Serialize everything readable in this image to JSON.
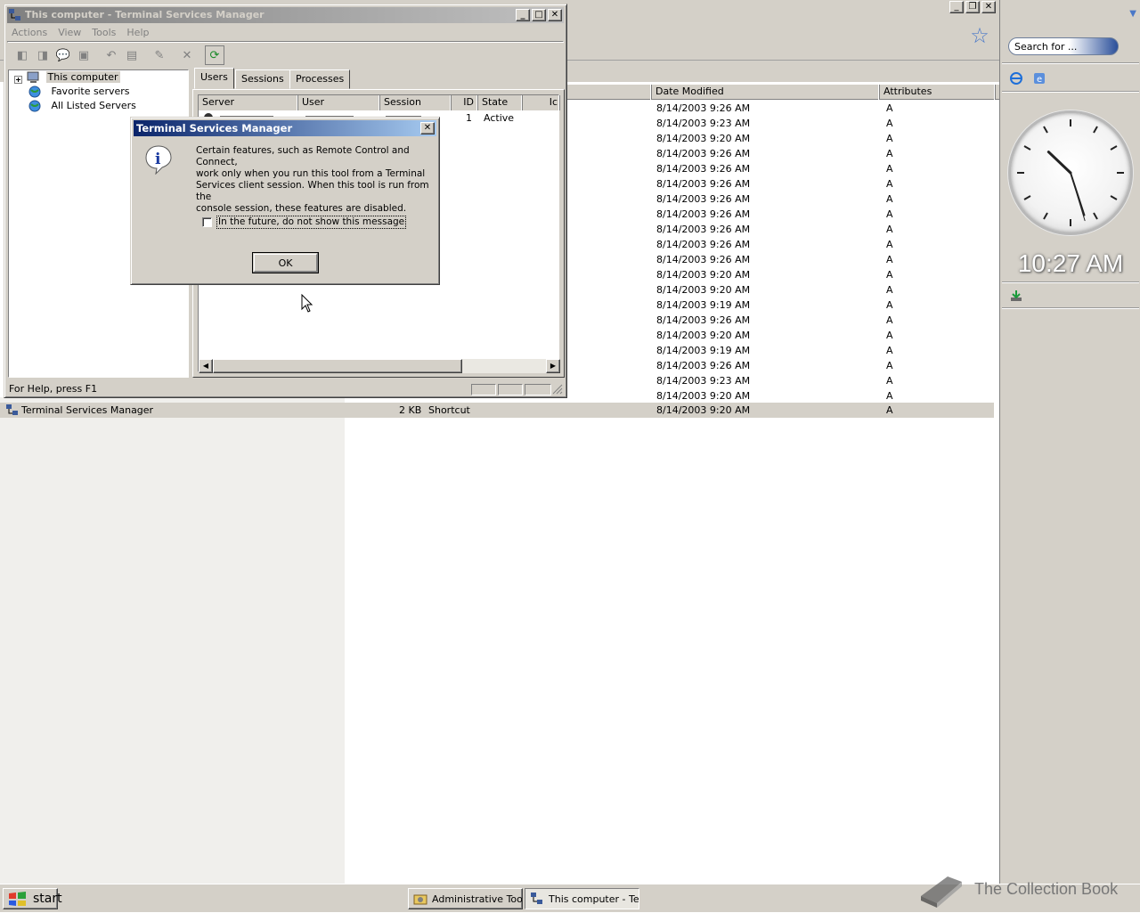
{
  "explorer": {
    "columns": [
      "Date Modified",
      "Attributes"
    ],
    "rows": [
      {
        "date": "8/14/2003 9:26 AM",
        "attr": "A"
      },
      {
        "date": "8/14/2003 9:23 AM",
        "attr": "A"
      },
      {
        "date": "8/14/2003 9:20 AM",
        "attr": "A"
      },
      {
        "date": "8/14/2003 9:26 AM",
        "attr": "A"
      },
      {
        "date": "8/14/2003 9:26 AM",
        "attr": "A"
      },
      {
        "date": "8/14/2003 9:26 AM",
        "attr": "A"
      },
      {
        "date": "8/14/2003 9:26 AM",
        "attr": "A"
      },
      {
        "date": "8/14/2003 9:26 AM",
        "attr": "A"
      },
      {
        "date": "8/14/2003 9:26 AM",
        "attr": "A"
      },
      {
        "date": "8/14/2003 9:26 AM",
        "attr": "A"
      },
      {
        "date": "8/14/2003 9:26 AM",
        "attr": "A"
      },
      {
        "date": "8/14/2003 9:20 AM",
        "attr": "A"
      },
      {
        "date": "8/14/2003 9:20 AM",
        "attr": "A"
      },
      {
        "date": "8/14/2003 9:19 AM",
        "attr": "A"
      },
      {
        "date": "8/14/2003 9:26 AM",
        "attr": "A"
      },
      {
        "date": "8/14/2003 9:20 AM",
        "attr": "A"
      },
      {
        "date": "8/14/2003 9:19 AM",
        "attr": "A"
      },
      {
        "date": "8/14/2003 9:26 AM",
        "attr": "A"
      },
      {
        "date": "8/14/2003 9:23 AM",
        "attr": "A"
      },
      {
        "date": "8/14/2003 9:20 AM",
        "attr": "A"
      }
    ],
    "selected_row": {
      "name": "Terminal Services Manager",
      "size": "2 KB",
      "type": "Shortcut",
      "date": "8/14/2003 9:20 AM",
      "attr": "A"
    }
  },
  "sidebar": {
    "search_placeholder": "Search for ...",
    "clock_time": "10:27 AM"
  },
  "tsm": {
    "title": "This computer - Terminal Services Manager",
    "menu": [
      "Actions",
      "View",
      "Tools",
      "Help"
    ],
    "tree": [
      "This computer",
      "Favorite servers",
      "All Listed Servers"
    ],
    "tabs": [
      "Users",
      "Sessions",
      "Processes"
    ],
    "columns": [
      "Server",
      "User",
      "Session",
      "ID",
      "State",
      "Ic"
    ],
    "row": {
      "id": "1",
      "state": "Active"
    },
    "status": "For Help, press F1"
  },
  "msgbox": {
    "title": "Terminal Services Manager",
    "text": "Certain features, such as Remote Control and Connect,\nwork only when you run this tool from a Terminal\nServices client session.  When this tool is run from the\nconsole session, these features are disabled.",
    "checkbox_label": "In the future, do not show this message",
    "checked": false,
    "ok_label": "OK"
  },
  "taskbar": {
    "start_label": "start",
    "tasks": [
      "Administrative Tools",
      "This computer - Terminal Services Manager"
    ]
  },
  "watermark": "The Collection Book",
  "colors": {
    "title_active": "#0a246a",
    "title_inactive": "#808080",
    "face": "#d4d0c8"
  }
}
